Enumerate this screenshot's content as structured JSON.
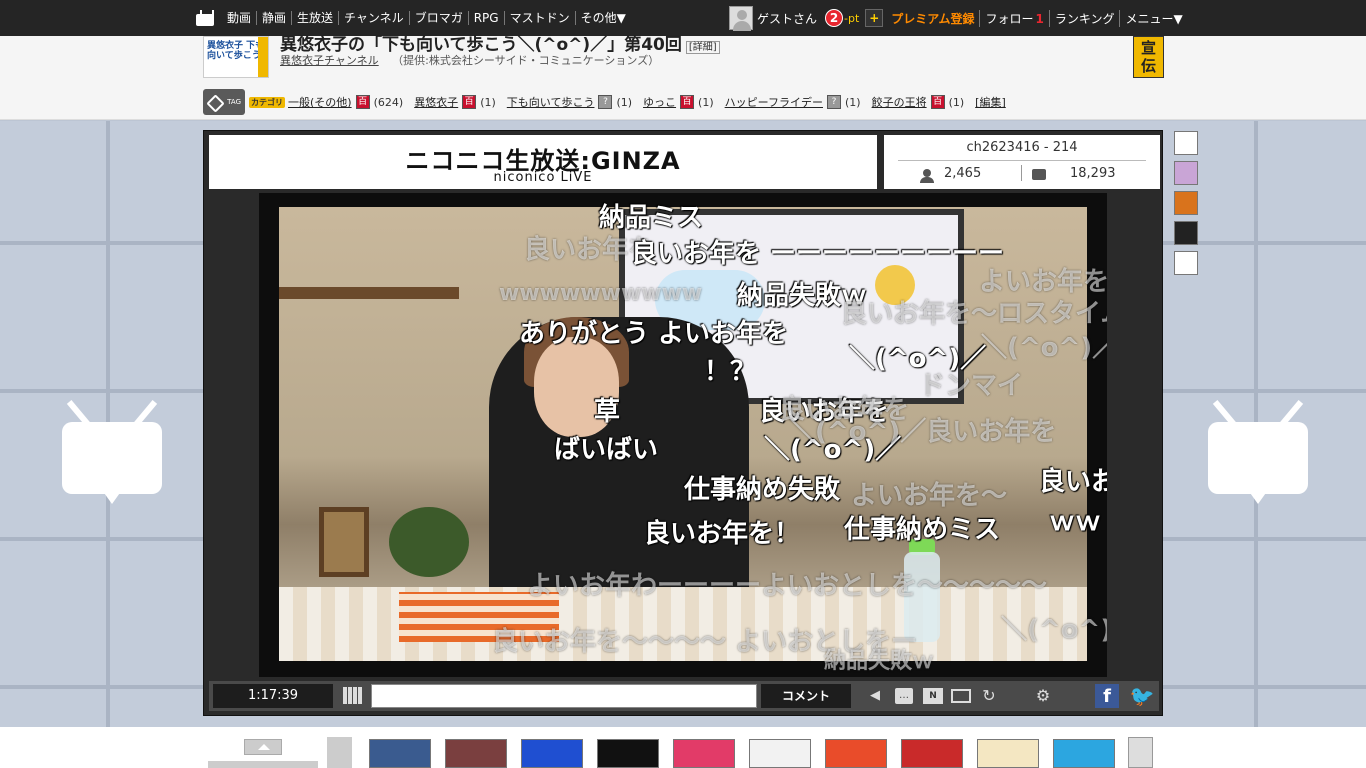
{
  "topbar": {
    "nav": [
      "動画",
      "静画",
      "生放送",
      "チャンネル",
      "ブロマガ",
      "RPG",
      "マストドン",
      "その他▼"
    ],
    "user": "ゲストさん",
    "points": "2",
    "points_unit": "-pt",
    "plus": "+",
    "premium": "プレミアム登録",
    "follow": "フォロー",
    "follow_count": "1",
    "ranking": "ランキング",
    "menu": "メニュー▼"
  },
  "program": {
    "title": "異悠衣子の「下も向いて歩こう＼(^o^)／」第40回",
    "detail": "[詳細]",
    "channel": "異悠衣子チャンネル",
    "provider": "（提供:株式会社シーサイド・コミュニケーションズ）",
    "senden": "宣伝",
    "thumb_text": "異悠衣子 下も向いて歩こう"
  },
  "tags": {
    "label": "TAG",
    "category": "カテゴリ",
    "items": [
      {
        "name": "一般(その他)",
        "badge": "百",
        "count": "(624)"
      },
      {
        "name": "異悠衣子",
        "badge": "百",
        "count": "(1)"
      },
      {
        "name": "下も向いて歩こう",
        "badge": "?",
        "count": "(1)"
      },
      {
        "name": "ゆっこ",
        "badge": "百",
        "count": "(1)"
      },
      {
        "name": "ハッピーフライデー",
        "badge": "?",
        "count": "(1)"
      },
      {
        "name": "餃子の王将",
        "badge": "百",
        "count": "(1)"
      }
    ],
    "edit": "[編集]"
  },
  "player": {
    "logo_main": "ニコニコ生放送:GINZA",
    "logo_sub": "niconico LiVE",
    "channel_id": "ch2623416 - 214",
    "viewers": "2,465",
    "comments_count": "18,293",
    "elapsed": "1:17:39",
    "comment_placeholder": "",
    "comment_button": "コメント",
    "facebook": "f",
    "twitter": "🐦"
  },
  "comments": [
    {
      "text": "納品ミス",
      "ghost": false
    },
    {
      "text": "良いお年を",
      "ghost": true
    },
    {
      "text": "良いお年を ーーーーーーーーー",
      "ghost": false
    },
    {
      "text": "wwwwwwwwww",
      "ghost": true
    },
    {
      "text": "納品失敗ｗ",
      "ghost": false
    },
    {
      "text": "ありがとう よいお年を",
      "ghost": false
    },
    {
      "text": "！？",
      "ghost": false
    },
    {
      "text": "＼(^o^)／",
      "ghost": false
    },
    {
      "text": "草",
      "ghost": false
    },
    {
      "text": "良いお年を",
      "ghost": false
    },
    {
      "text": "ばいばい",
      "ghost": false
    },
    {
      "text": "＼(^o^)／",
      "ghost": false
    },
    {
      "text": "仕事納め失敗",
      "ghost": false
    },
    {
      "text": "良いお年を！",
      "ghost": false
    },
    {
      "text": "仕事納めミス",
      "ghost": false
    },
    {
      "text": "よいお年を～",
      "ghost": true
    },
    {
      "text": "ｗｗ",
      "ghost": false
    },
    {
      "text": "良いお",
      "ghost": false
    },
    {
      "text": "よいお年わーーーーよいおとしを～～～～～",
      "ghost": true
    },
    {
      "text": "良いお年を～～～～ よいおとしをー",
      "ghost": true
    },
    {
      "text": "＼(^o^)",
      "ghost": true
    },
    {
      "text": "納品失敗ｗ",
      "ghost": true
    },
    {
      "text": "よいお年を～",
      "ghost": true
    },
    {
      "text": "良いお年を～ロスタイム",
      "ghost": true
    },
    {
      "text": "＼(^o^)／良いお年を",
      "ghost": true
    },
    {
      "text": "ドンマイ",
      "ghost": true
    },
    {
      "text": "＼(^o^)／良いお年を",
      "ghost": true
    },
    {
      "text": "良いお年を",
      "ghost": true
    }
  ],
  "colors": {
    "topbar_bg": "#252525",
    "premium": "#ff8a00",
    "accent_yellow": "#f0b800",
    "badge_red": "#c8102e"
  }
}
